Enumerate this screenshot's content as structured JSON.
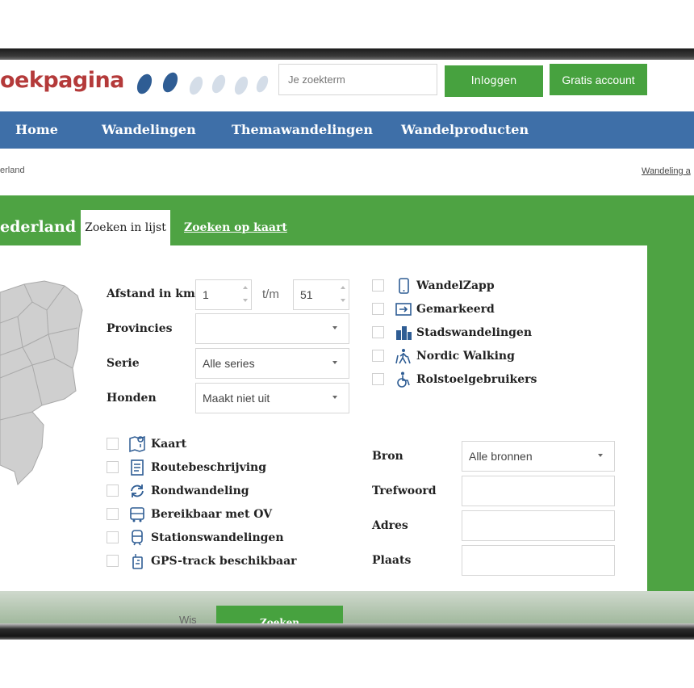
{
  "header": {
    "logo_text": "oekpagina",
    "search_placeholder": "Je zoekterm",
    "login_label": "Inloggen",
    "account_label": "Gratis account"
  },
  "nav": {
    "items": [
      {
        "label": "Home"
      },
      {
        "label": "Wandelingen"
      },
      {
        "label": "Themawandelingen"
      },
      {
        "label": "Wandelproducten"
      }
    ]
  },
  "breadcrumb": {
    "text": "erland",
    "right_link": "Wandeling a"
  },
  "search_panel": {
    "region_title": "ederland",
    "tabs": {
      "active": "Zoeken in lijst",
      "link": "Zoeken op kaart"
    },
    "fields": {
      "distance_label": "Afstand in km's",
      "distance_from": "1",
      "distance_separator": "t/m",
      "distance_to": "51",
      "provinces_label": "Provincies",
      "provinces_value": "",
      "serie_label": "Serie",
      "serie_value": "Alle series",
      "dogs_label": "Honden",
      "dogs_value": "Maakt niet uit",
      "source_label": "Bron",
      "source_value": "Alle bronnen",
      "keyword_label": "Trefwoord",
      "keyword_value": "",
      "address_label": "Adres",
      "address_value": "",
      "place_label": "Plaats",
      "place_value": ""
    },
    "right_options": [
      {
        "label": "WandelZapp",
        "icon": "phone-icon"
      },
      {
        "label": "Gemarkeerd",
        "icon": "arrow-marker-icon"
      },
      {
        "label": "Stadswandelingen",
        "icon": "city-icon"
      },
      {
        "label": "Nordic Walking",
        "icon": "nordic-walking-icon"
      },
      {
        "label": "Rolstoelgebruikers",
        "icon": "wheelchair-icon"
      }
    ],
    "left_options": [
      {
        "label": "Kaart",
        "icon": "map-pin-icon"
      },
      {
        "label": "Routebeschrijving",
        "icon": "document-icon"
      },
      {
        "label": "Rondwandeling",
        "icon": "loop-arrows-icon"
      },
      {
        "label": "Bereikbaar met OV",
        "icon": "bus-icon"
      },
      {
        "label": "Stationswandelingen",
        "icon": "train-icon"
      },
      {
        "label": "GPS-track beschikbaar",
        "icon": "gps-icon"
      }
    ],
    "actions": {
      "clear_label": "Wis",
      "search_label": "Zoeken"
    }
  },
  "colors": {
    "nav_blue": "#3e6fa8",
    "brand_green": "#47a23f",
    "logo_red": "#b43a3a",
    "icon_blue": "#2f5d94"
  }
}
